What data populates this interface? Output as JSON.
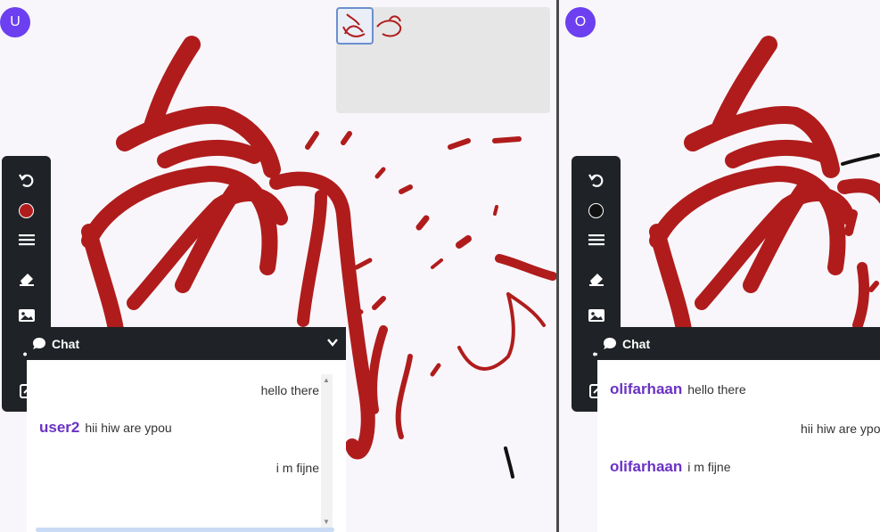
{
  "left_user": {
    "avatar_initial": "U"
  },
  "right_user": {
    "avatar_initial": "O"
  },
  "colors": {
    "accent": "#6c3ff0",
    "ink_red": "#b01c1c",
    "ink_black": "#111111",
    "toolbar_bg": "#1f2226",
    "sender_name": "#6a32c4"
  },
  "toolbar_icons": [
    "undo-icon",
    "color-picker",
    "stroke-width-icon",
    "eraser-icon",
    "image-icon",
    "more-icon",
    "export-icon"
  ],
  "left_toolbar": {
    "active_color": "#b01c1c"
  },
  "right_toolbar": {
    "active_color": "#111111"
  },
  "chat_left": {
    "title": "Chat",
    "messages": [
      {
        "sender": "",
        "text": "hello there",
        "own": true
      },
      {
        "sender": "user2",
        "text": "hii hiw are ypou",
        "own": false
      },
      {
        "sender": "",
        "text": "i m fijne",
        "own": true
      }
    ]
  },
  "chat_right": {
    "title": "Chat",
    "messages": [
      {
        "sender": "olifarhaan",
        "text": "hello there",
        "own": false
      },
      {
        "sender": "",
        "text": "hii hiw are ypo",
        "own": true
      },
      {
        "sender": "olifarhaan",
        "text": "i m fijne",
        "own": false
      }
    ]
  }
}
